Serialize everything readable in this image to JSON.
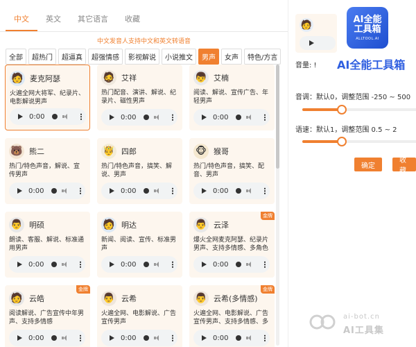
{
  "tabs": [
    {
      "label": "中文",
      "active": true
    },
    {
      "label": "英文"
    },
    {
      "label": "其它语言"
    },
    {
      "label": "收藏"
    }
  ],
  "subtitle": "中文发音人支持中文和英文转语音",
  "categories": [
    {
      "label": "全部"
    },
    {
      "label": "超热门"
    },
    {
      "label": "超逼真"
    },
    {
      "label": "超强情感"
    },
    {
      "label": "影视解说"
    },
    {
      "label": "小说推文"
    },
    {
      "label": "男声",
      "active": true
    },
    {
      "label": "女声"
    },
    {
      "label": "特色/方言"
    }
  ],
  "player": {
    "time": "0:00"
  },
  "voices": [
    {
      "name": "麦克阿瑟",
      "desc": "火遍全网大将军、纪录片、电影解说男声",
      "icon": "man-avatar-icon",
      "emoji": "🧑",
      "bg": "#dde9f5",
      "selected": true
    },
    {
      "name": "艾祥",
      "desc": "热门配音、演讲、解说、纪录片、磁性男声",
      "icon": "bearded-man-avatar-icon",
      "emoji": "🧔",
      "bg": "#efe8de"
    },
    {
      "name": "艾楠",
      "desc": "阅读、解说、宣传广告、年轻男声",
      "icon": "young-man-avatar-icon",
      "emoji": "👦",
      "bg": "#e9e9e9"
    },
    {
      "name": "熊二",
      "desc": "热门/特色声音，解说、宣传男声",
      "icon": "bear-avatar-icon",
      "emoji": "🐻",
      "bg": "#f3e5d3"
    },
    {
      "name": "四郎",
      "desc": "热门/特色声音，搞笑、解说、男声",
      "icon": "emperor-avatar-icon",
      "emoji": "🤴",
      "bg": "#f3ecd8"
    },
    {
      "name": "猴哥",
      "desc": "热门/特色声音，搞笑、配音、男声",
      "icon": "monkey-avatar-icon",
      "emoji": "🐵",
      "bg": "#f5e8cf"
    },
    {
      "name": "明硕",
      "desc": "朗读、客服、解说、标准通用男声",
      "icon": "man-avatar-icon",
      "emoji": "👨",
      "bg": "#e8e8e8"
    },
    {
      "name": "明达",
      "desc": "新闻、阅读、宣传、标准男声",
      "icon": "man-avatar-icon",
      "emoji": "🧑",
      "bg": "#dde9f5"
    },
    {
      "name": "云泽",
      "desc": "爆火全网麦克阿瑟、纪录片男声、支持多情感、多角色",
      "icon": "man-avatar-icon",
      "emoji": "👨",
      "bg": "#e8e8e8",
      "badge": "金牌"
    },
    {
      "name": "云皓",
      "desc": "阅读解说、广告宣传中年男声、支持多情感",
      "icon": "man-avatar-icon",
      "emoji": "🧑",
      "bg": "#e6e6e6",
      "badge": "金牌"
    },
    {
      "name": "云希",
      "desc": "火遍全网、电影解说、广告宣传男声",
      "icon": "man-avatar-icon",
      "emoji": "👨",
      "bg": "#efe6dc"
    },
    {
      "name": "云希(多情感)",
      "desc": "火遍全网、电影解说、广告宣传男声、支持多情感、多角色",
      "icon": "man-avatar-icon",
      "emoji": "👨",
      "bg": "#efe6dc",
      "badge": "金牌"
    }
  ],
  "right": {
    "logo": {
      "line1": "AI全能",
      "line2": "工具箱",
      "line3": "ALLTOOL.AI"
    },
    "logo_title": "AI全能工具箱",
    "volume_label": "音量: !",
    "pitch_label": "音调：默认0，调整范围 -250 ~ 500",
    "pitch_value": 0,
    "speed_label": "语速：默认1，调整范围 0.5 ~ 2",
    "speed_value": 1,
    "confirm": "确定",
    "favorite": "收藏"
  },
  "watermark": {
    "url": "ai-bot.cn",
    "text": "AI工具集"
  }
}
